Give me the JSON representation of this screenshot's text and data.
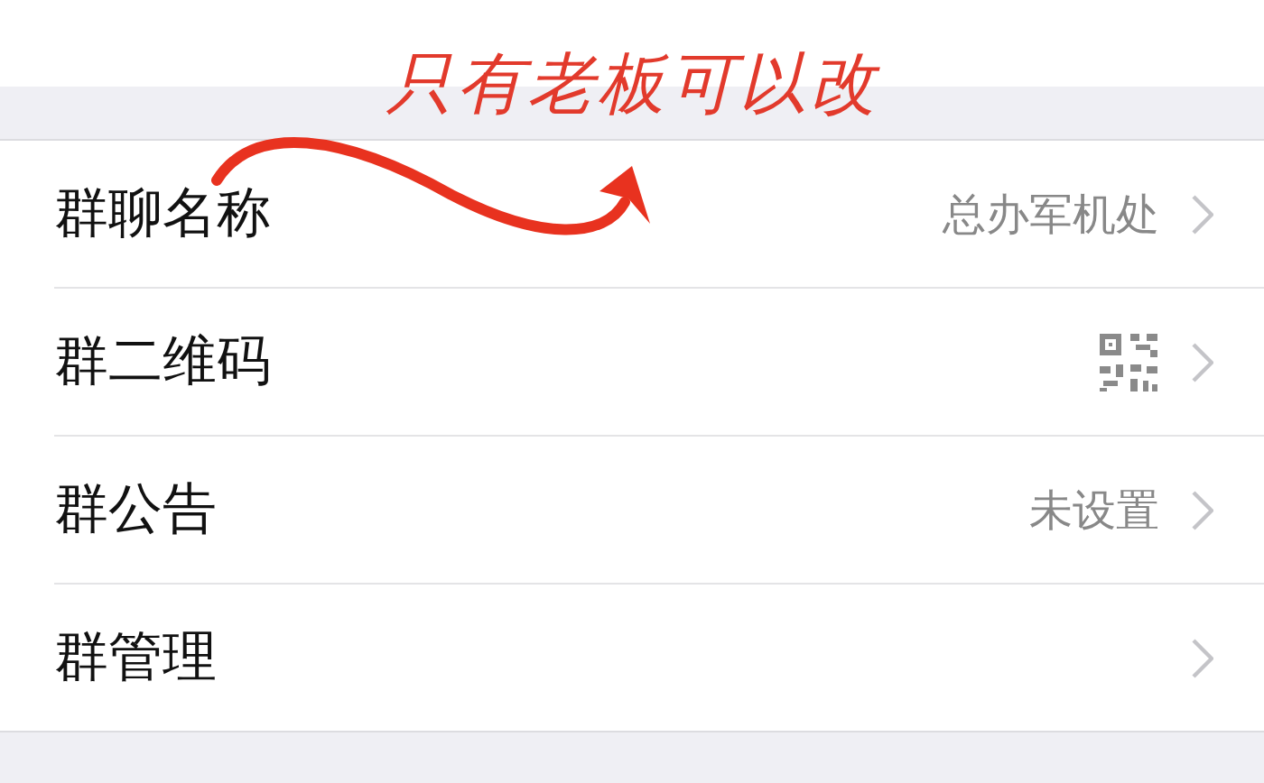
{
  "annotation": {
    "note": "只有老板可以改"
  },
  "rows": [
    {
      "label": "群聊名称",
      "kind": "text",
      "value": "总办军机处"
    },
    {
      "label": "群二维码",
      "kind": "qr"
    },
    {
      "label": "群公告",
      "kind": "text",
      "value": "未设置"
    },
    {
      "label": "群管理",
      "kind": "none"
    }
  ]
}
